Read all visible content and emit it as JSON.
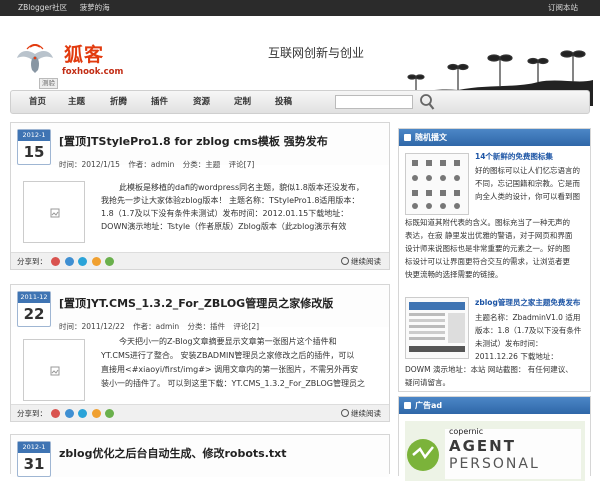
{
  "topbar": {
    "links": [
      "ZBlogger社区",
      "菠萝的海"
    ],
    "subscribe": "订阅本站"
  },
  "header": {
    "logo_cn": "狐客",
    "logo_en": "foxhook.com",
    "badge": "测验",
    "slogan": "互联网创新与创业"
  },
  "nav": {
    "items": [
      "首页",
      "主题",
      "折腾",
      "插件",
      "资源",
      "定制",
      "投稿"
    ],
    "search_placeholder": ""
  },
  "posts": [
    {
      "year_month": "2012-1",
      "day": "15",
      "title": "[置顶]TStylePro1.8 for zblog cms模板 强势发布",
      "time": "时间：2012/1/15",
      "author": "作者：admin",
      "category": "分类：主题",
      "comments": "评论[7]",
      "lines": [
        "此模板是移植的dafi的wordpress同名主题，貌似1.8版本还没发布，",
        "我抢先一步让大家体验zblog版本！ 主题名称：TStylePro1.8适用版本：",
        "1.8（1.7及以下没有条件未测试）发布时间：2012.01.15下载地址：",
        "DOWN演示地址：Tstyle（作者原版）Zblog版本（此zblog演示有效"
      ],
      "share": "分享到：",
      "read_more": "继续阅读"
    },
    {
      "year_month": "2011-12",
      "day": "22",
      "title": "[置顶]YT.CMS_1.3.2_For_ZBLOG管理员之家修改版",
      "time": "时间：2011/12/22",
      "author": "作者：admin",
      "category": "分类：插件",
      "comments": "评论[2]",
      "lines": [
        "今天把小一的Z-Blog文章摘要显示文章第一张图片这个插件和",
        "YT.CMS进行了整合。 安装ZBADMIN管理员之家修改之后的插件，可以",
        "直接用<#xiaoyi/first/img#> 调用文章内的第一张图片，不需另外再安",
        "装小一的插件了。 可以到这里下载：YT.CMS_1.3.2_For_ZBLOG管理员之"
      ],
      "share": "分享到：",
      "read_more": "继续阅读"
    },
    {
      "year_month": "2012-1",
      "day": "31",
      "title": "zblog优化之后台自动生成、修改robots.txt"
    }
  ],
  "sidebar": {
    "random_title": "随机播文",
    "item1": {
      "title": "14个新鲜的免费图标集",
      "lines": [
        "好的图标可以让人们忆忘语言的",
        "不同，忘记国籍和宗教。它是而",
        "向全人类的设计，你可以看到图",
        "标既知道其附代表的含义。图标充当了一种无声的",
        "表达，在寂 静里发出优雅的警语，对于网页和界面",
        "设计师来说图标也是非常重要的元素之一。好的图",
        "标设计可以让界面更符合交互的需求，让浏览者更",
        "快更流畅的选择需要的链接。"
      ]
    },
    "item2": {
      "title": "zblog管理员之家主题免费发布",
      "lines": [
        "主题名称：ZbadminV1.0 适用",
        "版本：1.8（1.7及以下没有条件",
        "未测试）发布时间：",
        "2011.12.26 下载地址：",
        "DOWM 演示地址：本站 网站截图： 有任何建议、",
        "疑问请留言。"
      ]
    },
    "ad_title": "广告ad",
    "ad_brand": "copernic",
    "ad_line1": "AGENT",
    "ad_line2": "PERSONAL"
  },
  "colors": {
    "accent": "#3f74b3",
    "brand_red": "#e23b0f",
    "topbar": "#2b2b2b"
  }
}
